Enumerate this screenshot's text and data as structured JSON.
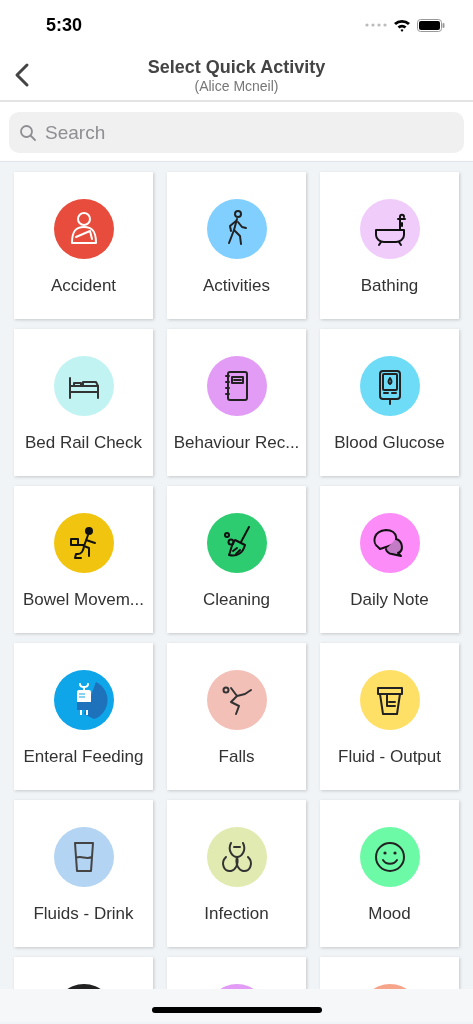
{
  "status_bar": {
    "time": "5:30"
  },
  "nav": {
    "title": "Select Quick Activity",
    "subtitle": "(Alice Mcneil)"
  },
  "search": {
    "placeholder": "Search"
  },
  "tiles": [
    {
      "label": "Accident",
      "kind": "accident",
      "color": "#e74c3c"
    },
    {
      "label": "Activities",
      "kind": "walk",
      "color": "#81cfff"
    },
    {
      "label": "Bathing",
      "kind": "bath",
      "color": "#f0ccfb"
    },
    {
      "label": "Bed Rail Check",
      "kind": "bed",
      "color": "#c2f3f3"
    },
    {
      "label": "Behaviour Rec...",
      "kind": "notebook",
      "color": "#e29cf5"
    },
    {
      "label": "Blood Glucose",
      "kind": "glucose",
      "color": "#6fdcf7"
    },
    {
      "label": "Bowel Movem...",
      "kind": "toilet",
      "color": "#f1c40f"
    },
    {
      "label": "Cleaning",
      "kind": "broom",
      "color": "#2ecc71"
    },
    {
      "label": "Daily Note",
      "kind": "chat",
      "color": "#fc8cf7"
    },
    {
      "label": "Enteral Feeding",
      "kind": "drip",
      "color": "#0ea5e9"
    },
    {
      "label": "Falls",
      "kind": "fall",
      "color": "#f3c0b8"
    },
    {
      "label": "Fluid - Output",
      "kind": "bucket",
      "color": "#ffe066"
    },
    {
      "label": "Fluids - Drink",
      "kind": "glass",
      "color": "#b3d4f2"
    },
    {
      "label": "Infection",
      "kind": "biohazard",
      "color": "#e1eab0"
    },
    {
      "label": "Mood",
      "kind": "smile",
      "color": "#6cfaa7"
    }
  ],
  "partial_tiles": [
    {
      "color": "#222222"
    },
    {
      "color": "#e29cf5"
    },
    {
      "color": "#f7a58a"
    }
  ]
}
